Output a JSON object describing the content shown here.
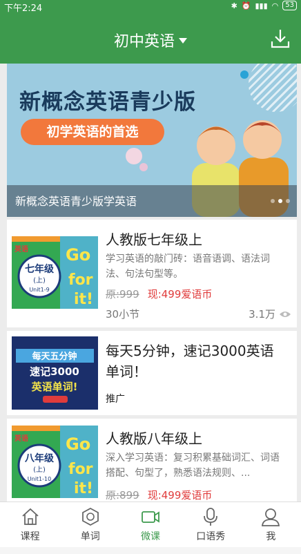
{
  "status_bar": {
    "time": "下午2:24",
    "battery": "53"
  },
  "header": {
    "title": "初中英语",
    "download_icon": "download-icon"
  },
  "banner": {
    "headline": "新概念英语青少版",
    "subline": "初学英语的首选",
    "caption": "新概念英语青少版学英语"
  },
  "courses": [
    {
      "title": "人教版七年级上",
      "desc": "学习英语的敲门砖：语音语调、语法词法、句法句型等。",
      "price_old": "原:999",
      "price_new": "现:499爱语币",
      "lessons": "30小节",
      "views": "3.1万",
      "thumb": {
        "badge": "英语",
        "grade": "七年级",
        "vol": "(上)",
        "unit": "Unit1-9"
      }
    },
    {
      "title": "每天5分钟，速记3000英语单词！",
      "tag": "推广",
      "thumb": {
        "line1": "每天五分钟",
        "line2": "速记3000",
        "line3": "英语单词!"
      }
    },
    {
      "title": "人教版八年级上",
      "desc": "深入学习英语：复习积累基础词汇、词语搭配、句型了，熟悉语法规则、...",
      "price_old": "原:899",
      "price_new": "现:499爱语币",
      "thumb": {
        "badge": "英语",
        "grade": "八年级",
        "vol": "(上)",
        "unit": "Unit1-10"
      }
    }
  ],
  "tabs": [
    {
      "label": "课程",
      "icon": "home-icon"
    },
    {
      "label": "单词",
      "icon": "word-icon"
    },
    {
      "label": "微课",
      "icon": "video-icon",
      "active": true
    },
    {
      "label": "口语秀",
      "icon": "microphone-icon"
    },
    {
      "label": "我",
      "icon": "user-icon"
    }
  ],
  "colors": {
    "primary": "#3d9a4d",
    "price": "#e03c3c",
    "accent_orange": "#f2783c"
  }
}
